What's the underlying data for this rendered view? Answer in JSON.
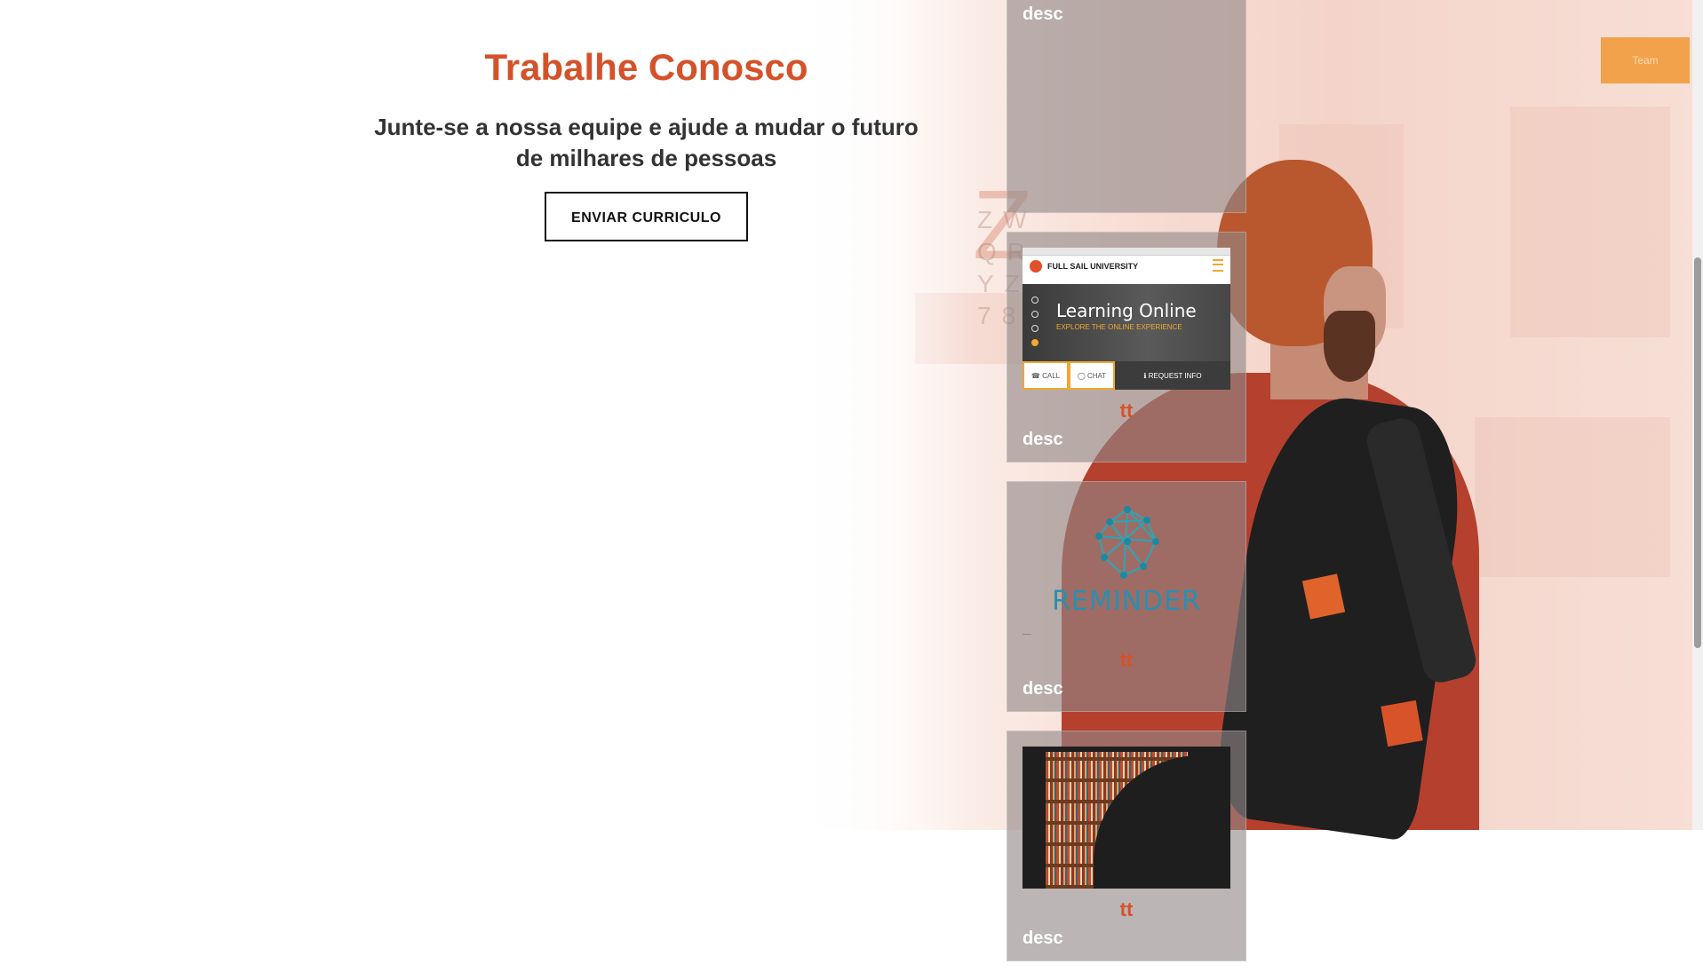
{
  "careers": {
    "title": "Trabalhe Conosco",
    "subtitle": "Junte-se a nossa equipe e ajude a mudar o futuro de milhares de pessoas",
    "button": "ENVIAR CURRICULO"
  },
  "cards": [
    {
      "title": "",
      "desc": "desc",
      "thumb": "none"
    },
    {
      "title": "tt",
      "desc": "desc",
      "thumb": "full-sail-screenshot",
      "preview": {
        "brand": "FULL SAIL UNIVERSITY",
        "headline": "Learning Online",
        "tagline": "EXPLORE THE ONLINE EXPERIENCE",
        "call": "CALL",
        "chat": "CHAT",
        "request": "REQUEST INFO"
      }
    },
    {
      "title": "tt",
      "desc": "desc",
      "thumb": "reminder-logo",
      "preview": {
        "word": "REMINDER"
      }
    },
    {
      "title": "tt",
      "desc": "desc",
      "thumb": "library-screenshot"
    }
  ],
  "colors": {
    "accent": "#d4522a",
    "text": "#333333",
    "card_overlay": "rgba(145,135,135,0.62)"
  }
}
